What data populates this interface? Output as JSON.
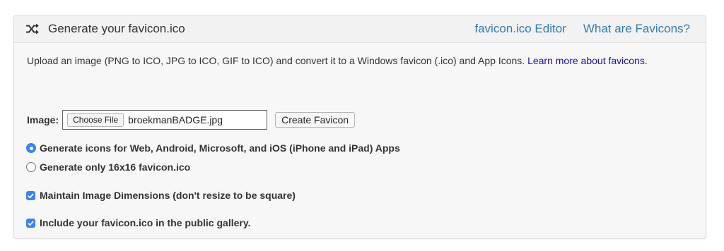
{
  "header": {
    "title": "Generate your favicon.ico",
    "icon": "shuffle-icon",
    "links": [
      "favicon.ico Editor",
      "What are Favicons?"
    ]
  },
  "intro": {
    "text": "Upload an image (PNG to ICO, JPG to ICO, GIF to ICO) and convert it to a Windows favicon (.ico) and App Icons. ",
    "link": "Learn more about favicons."
  },
  "image_field": {
    "label": "Image:",
    "choose_label": "Choose File",
    "file_name": "broekmanBADGE.jpg"
  },
  "create_button": "Create Favicon",
  "options": {
    "radio_all": {
      "label": "Generate icons for Web, Android, Microsoft, and iOS (iPhone and iPad) Apps",
      "checked": true
    },
    "radio_16": {
      "label": "Generate only 16x16 favicon.ico",
      "checked": false
    },
    "maintain_dimensions": {
      "label": "Maintain Image Dimensions (don't resize to be square)",
      "checked": true
    },
    "public_gallery": {
      "label": "Include your favicon.ico in the public gallery.",
      "checked": true
    }
  },
  "colors": {
    "link": "#337ab7",
    "accent": "#3b82f6",
    "panel_bg": "#f7f7f7"
  }
}
